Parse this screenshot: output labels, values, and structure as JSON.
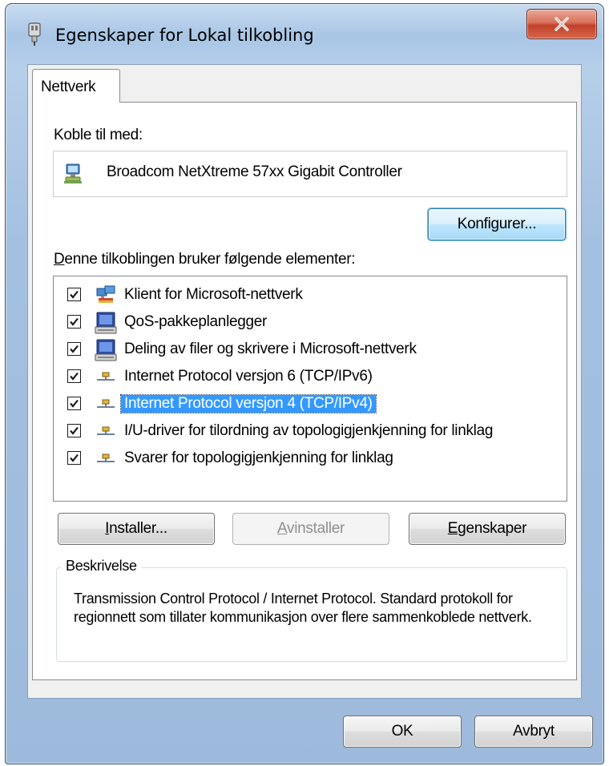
{
  "window": {
    "title": "Egenskaper for Lokal tilkobling",
    "close_symbol": "X",
    "icon": "network-adapter-icon"
  },
  "tabs": [
    {
      "label": "Nettverk",
      "active": true
    }
  ],
  "connect": {
    "label": "Koble til med:",
    "adapter_name": "Broadcom NetXtreme 57xx Gigabit Controller",
    "configure_button": "Konfigurer..."
  },
  "components": {
    "label": "Denne tilkoblingen bruker følgende elementer:",
    "items": [
      {
        "label": "Klient for Microsoft-nettverk",
        "checked": true,
        "icon": "network-client-icon",
        "selected": false
      },
      {
        "label": "QoS-pakkeplanlegger",
        "checked": true,
        "icon": "network-service-icon",
        "selected": false
      },
      {
        "label": "Deling av filer og skrivere i Microsoft-nettverk",
        "checked": true,
        "icon": "network-service-icon",
        "selected": false
      },
      {
        "label": "Internet Protocol versjon 6 (TCP/IPv6)",
        "checked": true,
        "icon": "network-protocol-icon",
        "selected": false
      },
      {
        "label": "Internet Protocol versjon 4 (TCP/IPv4)",
        "checked": true,
        "icon": "network-protocol-icon",
        "selected": true
      },
      {
        "label": "I/U-driver for tilordning av topologigjenkjenning for linklag",
        "checked": true,
        "icon": "network-protocol-icon",
        "selected": false
      },
      {
        "label": "Svarer for topologigjenkjenning for linklag",
        "checked": true,
        "icon": "network-protocol-icon",
        "selected": false
      }
    ]
  },
  "actions": {
    "install": "Installer...",
    "uninstall": "Avinstaller",
    "properties": "Egenskaper"
  },
  "description": {
    "legend": "Beskrivelse",
    "text": "Transmission Control Protocol / Internet Protocol. Standard protokoll for regionnett som tillater kommunikasjon over flere sammenkoblede nettverk."
  },
  "footer": {
    "ok": "OK",
    "cancel": "Avbryt"
  },
  "colors": {
    "selection": "#3399ff",
    "default_button_border": "#3c7fb1",
    "close_button": "#c2402a"
  }
}
